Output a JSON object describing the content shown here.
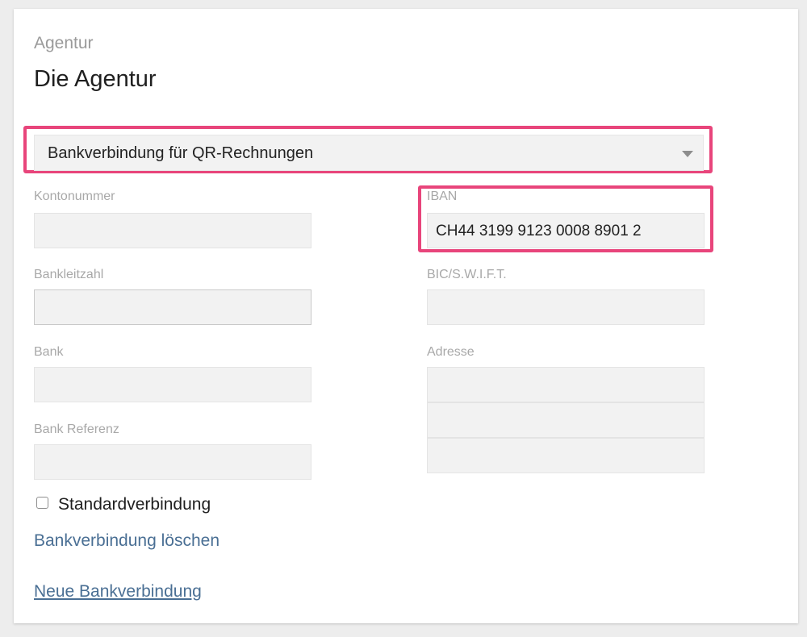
{
  "header": {
    "section_label": "Agentur",
    "title": "Die Agentur"
  },
  "account_select": {
    "value": "Bankverbindung für QR-Rechnungen"
  },
  "fields": {
    "kontonummer": {
      "label": "Kontonummer",
      "value": ""
    },
    "iban": {
      "label": "IBAN",
      "value": "CH44 3199 9123 0008 8901 2"
    },
    "bankleitzahl": {
      "label": "Bankleitzahl",
      "value": ""
    },
    "bic": {
      "label": "BIC/S.W.I.F.T.",
      "value": ""
    },
    "bank": {
      "label": "Bank",
      "value": ""
    },
    "adresse": {
      "label": "Adresse",
      "lines": [
        "",
        "",
        ""
      ]
    },
    "bank_referenz": {
      "label": "Bank Referenz",
      "value": ""
    }
  },
  "default_checkbox": {
    "label": "Standardverbindung",
    "checked": false
  },
  "links": {
    "delete": "Bankverbindung löschen",
    "new": "Neue Bankverbindung"
  },
  "colors": {
    "highlight": "#e8457b",
    "link": "#4a6f94"
  }
}
